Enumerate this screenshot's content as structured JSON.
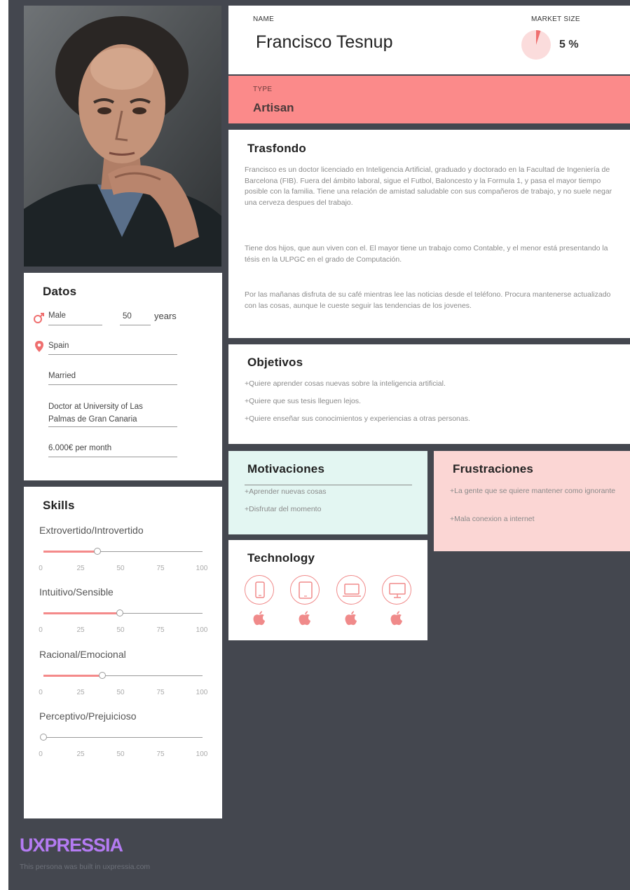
{
  "header": {
    "name_label": "NAME",
    "name": "Francisco Tesnup",
    "market_size_label": "MARKET SIZE",
    "market_size_value": "5 %",
    "market_size_fraction": 0.05
  },
  "type": {
    "label": "TYPE",
    "value": "Artisan"
  },
  "background": {
    "title": "Trasfondo",
    "paragraphs": [
      "Francisco es un doctor licenciado en Inteligencia Artificial, graduado y doctorado en la Facultad de Ingeniería de Barcelona (FIB). Fuera del ámbito laboral, sigue el Futbol, Baloncesto y la Formula 1, y pasa el mayor tiempo posible con la familia. Tiene una relación de amistad saludable con sus compañeros de trabajo, y no suele negar una cerveza despues del trabajo.",
      "Tiene dos hijos, que aun viven con el. El mayor tiene un trabajo como Contable, y el menor está presentando la tésis en la ULPGC en el grado de Computación.",
      "Por las mañanas disfruta de su café mientras lee las noticias desde el teléfono. Procura mantenerse actualizado con las cosas, aunque le cueste seguir las tendencias de los jovenes."
    ]
  },
  "goals": {
    "title": "Objetivos",
    "items": [
      "+Quiere aprender cosas nuevas sobre la inteligencia artificial.",
      "+Quiere que sus tesis lleguen lejos.",
      "+Quiere enseñar sus conocimientos y experiencias a otras personas."
    ]
  },
  "motivations": {
    "title": "Motivaciones",
    "items": [
      "+Aprender nuevas cosas",
      "+Disfrutar del momento"
    ]
  },
  "frustrations": {
    "title": "Frustraciones",
    "items": [
      "+La gente que se quiere mantener como ignorante",
      "+Mala conexion a internet"
    ]
  },
  "technology": {
    "title": "Technology",
    "devices": [
      "smartphone-icon",
      "tablet-icon",
      "laptop-icon",
      "desktop-icon"
    ],
    "platform_icon": "apple-icon",
    "accent": "#f08a8a"
  },
  "datos": {
    "title": "Datos",
    "gender": "Male",
    "age": "50",
    "age_unit": "years",
    "country": "Spain",
    "status": "Married",
    "job": "Doctor at University of Las Palmas de Gran Canaria",
    "income": "6.000€ per month"
  },
  "skills": {
    "title": "Skills",
    "ticks": [
      "0",
      "25",
      "50",
      "75",
      "100"
    ],
    "items": [
      {
        "label": "Extrovertido/Introvertido",
        "value": 34
      },
      {
        "label": "Intuitivo/Sensible",
        "value": 48
      },
      {
        "label": "Racional/Emocional",
        "value": 37
      },
      {
        "label": "Perceptivo/Prejuicioso",
        "value": 0
      }
    ]
  },
  "footer": {
    "brand": "UXPRESSIA",
    "note": "This persona was built in uxpressia.com"
  },
  "colors": {
    "accent": "#fb8a8a",
    "background": "#44474f",
    "motivations_bg": "#e3f6f2",
    "frustrations_bg": "#fbd6d4",
    "brand": "#b47bf2"
  }
}
